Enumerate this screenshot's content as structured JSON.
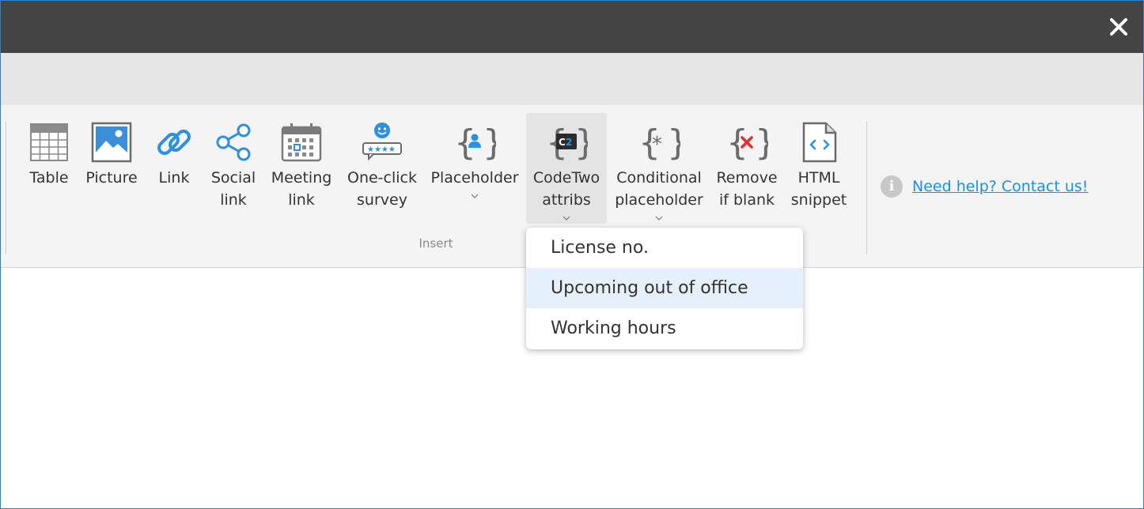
{
  "window": {
    "close_icon": "close-icon"
  },
  "ribbon": {
    "group_label": "Insert",
    "buttons": [
      {
        "id": "table",
        "label": "Table",
        "icon": "table-icon"
      },
      {
        "id": "picture",
        "label": "Picture",
        "icon": "picture-icon"
      },
      {
        "id": "link",
        "label": "Link",
        "icon": "link-icon"
      },
      {
        "id": "social-link",
        "label": "Social\nlink",
        "icon": "share-icon"
      },
      {
        "id": "meeting-link",
        "label": "Meeting\nlink",
        "icon": "calendar-icon"
      },
      {
        "id": "survey",
        "label": "One-click\nsurvey",
        "icon": "survey-icon"
      },
      {
        "id": "placeholder",
        "label": "Placeholder",
        "icon": "placeholder-icon"
      },
      {
        "id": "codetwo",
        "label": "CodeTwo\nattribs",
        "icon": "codetwo-icon"
      },
      {
        "id": "conditional",
        "label": "Conditional\nplaceholder",
        "icon": "conditional-placeholder-icon"
      },
      {
        "id": "remove-blank",
        "label": "Remove\nif blank",
        "icon": "remove-if-blank-icon"
      },
      {
        "id": "html-snippet",
        "label": "HTML\nsnippet",
        "icon": "html-snippet-icon"
      }
    ]
  },
  "help": {
    "icon": "info-icon",
    "info_glyph": "i",
    "link_text": "Need help? Contact us!"
  },
  "dropdown": {
    "items": [
      "License no.",
      "Upcoming out of office",
      "Working hours"
    ],
    "highlighted_index": 1
  },
  "colors": {
    "titlebar": "#444444",
    "accent_blue": "#1f8fe6",
    "highlight": "#e6f0fb",
    "remove_red": "#e03030"
  }
}
